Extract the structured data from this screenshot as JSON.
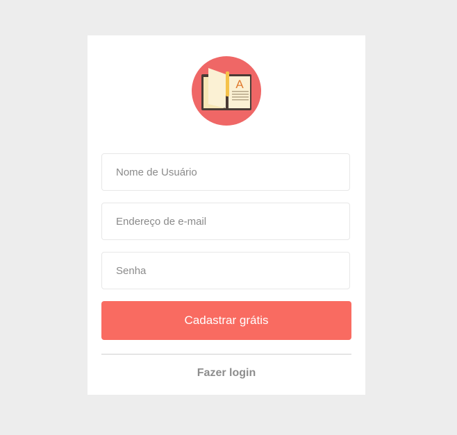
{
  "colors": {
    "background": "#ededed",
    "card": "#ffffff",
    "accent": "#f96b61",
    "logo_circle": "#ef6766",
    "link": "#8d8d8d"
  },
  "logo": {
    "icon": "open-book-icon",
    "letter": "A"
  },
  "form": {
    "username_placeholder": "Nome de Usuário",
    "email_placeholder": "Endereço de e-mail",
    "password_placeholder": "Senha",
    "submit_label": "Cadastrar grátis"
  },
  "footer": {
    "login_label": "Fazer login"
  }
}
